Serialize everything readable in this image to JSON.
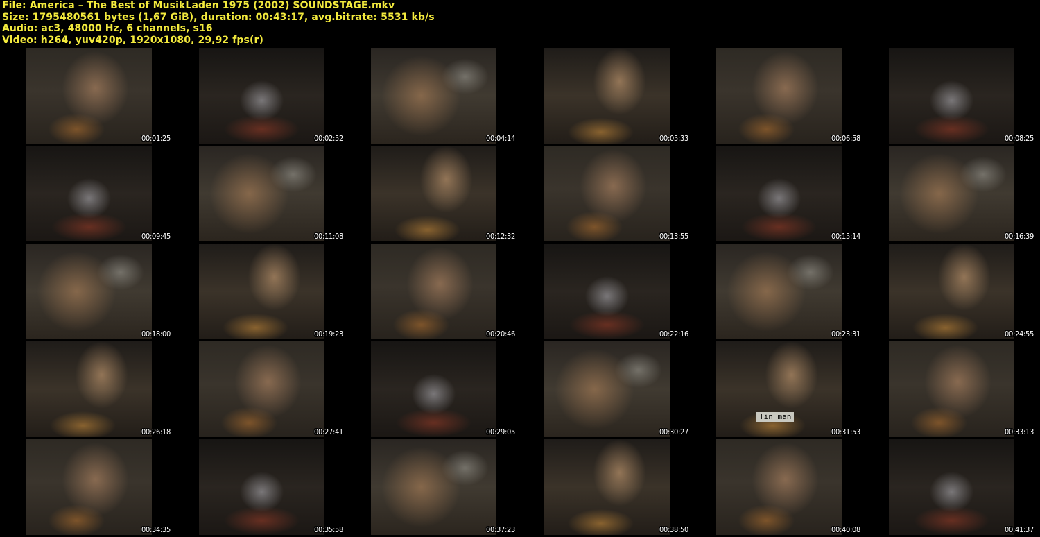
{
  "header": {
    "line1": "File: America – The Best of MusikLaden 1975 (2002) SOUNDSTAGE.mkv",
    "line2": "Size: 1795480561 bytes (1,67 GiB), duration: 00:43:17, avg.bitrate: 5531 kb/s",
    "line3": "Audio: ac3, 48000 Hz, 6 channels, s16",
    "line4": "Video: h264, yuv420p, 1920x1080, 29,92 fps(r)"
  },
  "thumbnails": [
    "00:01:25",
    "00:02:52",
    "00:04:14",
    "00:05:33",
    "00:06:58",
    "00:08:25",
    "00:09:45",
    "00:11:08",
    "00:12:32",
    "00:13:55",
    "00:15:14",
    "00:16:39",
    "00:18:00",
    "00:19:23",
    "00:20:46",
    "00:22:16",
    "00:23:31",
    "00:24:55",
    "00:26:18",
    "00:27:41",
    "00:29:05",
    "00:30:27",
    "00:31:53",
    "00:33:13",
    "00:34:35",
    "00:35:58",
    "00:37:23",
    "00:38:50",
    "00:40:08",
    "00:41:37"
  ],
  "overlay_caption": "Tin man",
  "colors": {
    "header_text": "#f3ea3d",
    "background": "#000000",
    "timecode_text": "#ffffff"
  }
}
